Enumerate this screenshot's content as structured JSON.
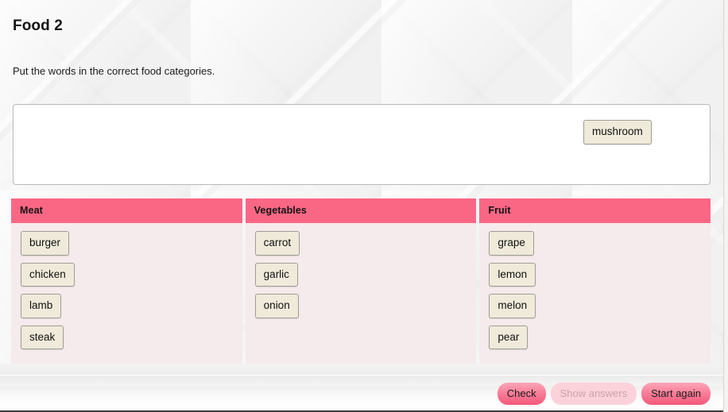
{
  "header": {
    "title": "Food 2",
    "instruction": "Put the words in the correct food categories."
  },
  "word_bank": {
    "items": [
      {
        "label": "mushroom"
      }
    ]
  },
  "categories": [
    {
      "name": "Meat",
      "items": [
        {
          "label": "burger"
        },
        {
          "label": "chicken"
        },
        {
          "label": "lamb"
        },
        {
          "label": "steak"
        }
      ]
    },
    {
      "name": "Vegetables",
      "items": [
        {
          "label": "carrot"
        },
        {
          "label": "garlic"
        },
        {
          "label": "onion"
        }
      ]
    },
    {
      "name": "Fruit",
      "items": [
        {
          "label": "grape"
        },
        {
          "label": "lemon"
        },
        {
          "label": "melon"
        },
        {
          "label": "pear"
        }
      ]
    }
  ],
  "buttons": {
    "check": {
      "label": "Check",
      "enabled": true
    },
    "show_answers": {
      "label": "Show answers",
      "enabled": false
    },
    "start_again": {
      "label": "Start again",
      "enabled": true
    }
  },
  "colors": {
    "header_pink": "#fa6785",
    "column_body": "#f5eaec",
    "tile_bg": "#efeada",
    "tile_border": "#9f9f96",
    "button_pink": "#f4587a",
    "button_disabled": "#fbd2da",
    "page_bg": "#f1f1f1"
  }
}
